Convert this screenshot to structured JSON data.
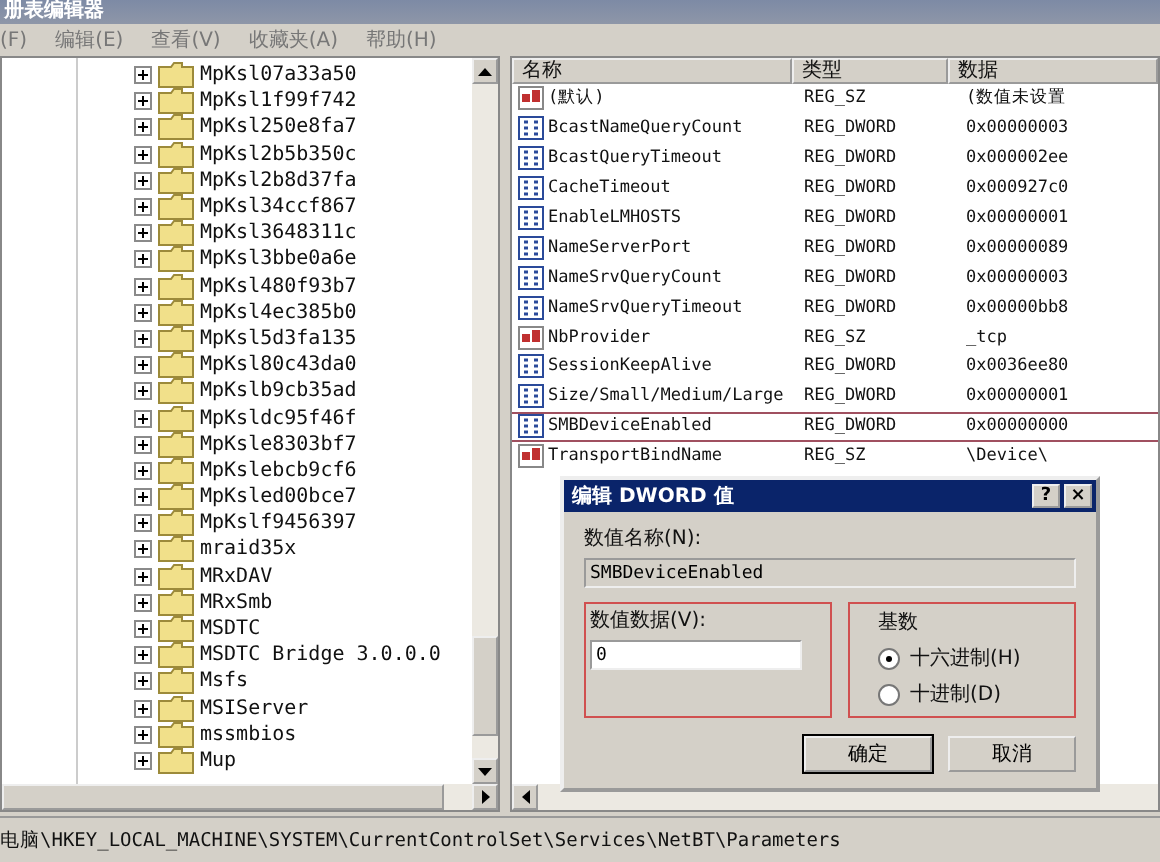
{
  "window": {
    "title": "册表编辑器"
  },
  "menu": [
    {
      "label": "(F)"
    },
    {
      "label": "编辑(E)"
    },
    {
      "label": "查看(V)"
    },
    {
      "label": "收藏夹(A)"
    },
    {
      "label": "帮助(H)"
    }
  ],
  "tree": {
    "items": [
      {
        "label": "MpKsl07a33a50",
        "expanded": false
      },
      {
        "label": "MpKsl1f99f742",
        "expanded": false
      },
      {
        "label": "MpKsl250e8fa7",
        "expanded": false
      },
      {
        "label": "MpKsl2b5b350c",
        "expanded": false
      },
      {
        "label": "MpKsl2b8d37fa",
        "expanded": false
      },
      {
        "label": "MpKsl34ccf867",
        "expanded": false
      },
      {
        "label": "MpKsl3648311c",
        "expanded": false
      },
      {
        "label": "MpKsl3bbe0a6e",
        "expanded": false
      },
      {
        "label": "MpKsl480f93b7",
        "expanded": false
      },
      {
        "label": "MpKsl4ec385b0",
        "expanded": false
      },
      {
        "label": "MpKsl5d3fa135",
        "expanded": false
      },
      {
        "label": "MpKsl80c43da0",
        "expanded": false
      },
      {
        "label": "MpKslb9cb35ad",
        "expanded": false
      },
      {
        "label": "MpKsldc95f46f",
        "expanded": false
      },
      {
        "label": "MpKsle8303bf7",
        "expanded": false
      },
      {
        "label": "MpKslebcb9cf6",
        "expanded": false
      },
      {
        "label": "MpKsled00bce7",
        "expanded": false
      },
      {
        "label": "MpKslf9456397",
        "expanded": false
      },
      {
        "label": "mraid35x",
        "expanded": false
      },
      {
        "label": "MRxDAV",
        "expanded": false
      },
      {
        "label": "MRxSmb",
        "expanded": false
      },
      {
        "label": "MSDTC",
        "expanded": false
      },
      {
        "label": "MSDTC Bridge 3.0.0.0",
        "expanded": false
      },
      {
        "label": "Msfs",
        "expanded": false
      },
      {
        "label": "MSIServer",
        "expanded": false
      },
      {
        "label": "mssmbios",
        "expanded": false
      },
      {
        "label": "Mup",
        "expanded": false
      }
    ]
  },
  "values": {
    "columns": [
      "名称",
      "类型",
      "数据"
    ],
    "rows": [
      {
        "kind": "string",
        "name": "(默认)",
        "type": "REG_SZ",
        "data": "(数值未设置",
        "highlighted": false
      },
      {
        "kind": "binary",
        "name": "BcastNameQueryCount",
        "type": "REG_DWORD",
        "data": "0x00000003",
        "highlighted": false
      },
      {
        "kind": "binary",
        "name": "BcastQueryTimeout",
        "type": "REG_DWORD",
        "data": "0x000002ee",
        "highlighted": false
      },
      {
        "kind": "binary",
        "name": "CacheTimeout",
        "type": "REG_DWORD",
        "data": "0x000927c0",
        "highlighted": false
      },
      {
        "kind": "binary",
        "name": "EnableLMHOSTS",
        "type": "REG_DWORD",
        "data": "0x00000001",
        "highlighted": false
      },
      {
        "kind": "binary",
        "name": "NameServerPort",
        "type": "REG_DWORD",
        "data": "0x00000089",
        "highlighted": false
      },
      {
        "kind": "binary",
        "name": "NameSrvQueryCount",
        "type": "REG_DWORD",
        "data": "0x00000003",
        "highlighted": false
      },
      {
        "kind": "binary",
        "name": "NameSrvQueryTimeout",
        "type": "REG_DWORD",
        "data": "0x00000bb8",
        "highlighted": false
      },
      {
        "kind": "string",
        "name": "NbProvider",
        "type": "REG_SZ",
        "data": "_tcp",
        "highlighted": false
      },
      {
        "kind": "binary",
        "name": "SessionKeepAlive",
        "type": "REG_DWORD",
        "data": "0x0036ee80",
        "highlighted": false
      },
      {
        "kind": "binary",
        "name": "Size/Small/Medium/Large",
        "type": "REG_DWORD",
        "data": "0x00000001",
        "highlighted": false
      },
      {
        "kind": "binary",
        "name": "SMBDeviceEnabled",
        "type": "REG_DWORD",
        "data": "0x00000000",
        "highlighted": true
      },
      {
        "kind": "string",
        "name": "TransportBindName",
        "type": "REG_SZ",
        "data": "\\Device\\",
        "highlighted": false
      }
    ]
  },
  "dialog": {
    "title": "编辑 DWORD 值",
    "help_button": "?",
    "close_button": "×",
    "name_label": "数值名称(N):",
    "name_value": "SMBDeviceEnabled",
    "data_label": "数值数据(V):",
    "data_value": "0",
    "radix_label": "基数",
    "radix_options": [
      {
        "label": "十六进制(H)",
        "selected": true
      },
      {
        "label": "十进制(D)",
        "selected": false
      }
    ],
    "buttons": [
      "确定",
      "取消"
    ]
  },
  "status_bar": {
    "path": "电脑\\HKEY_LOCAL_MACHINE\\SYSTEM\\CurrentControlSet\\Services\\NetBT\\Parameters"
  }
}
